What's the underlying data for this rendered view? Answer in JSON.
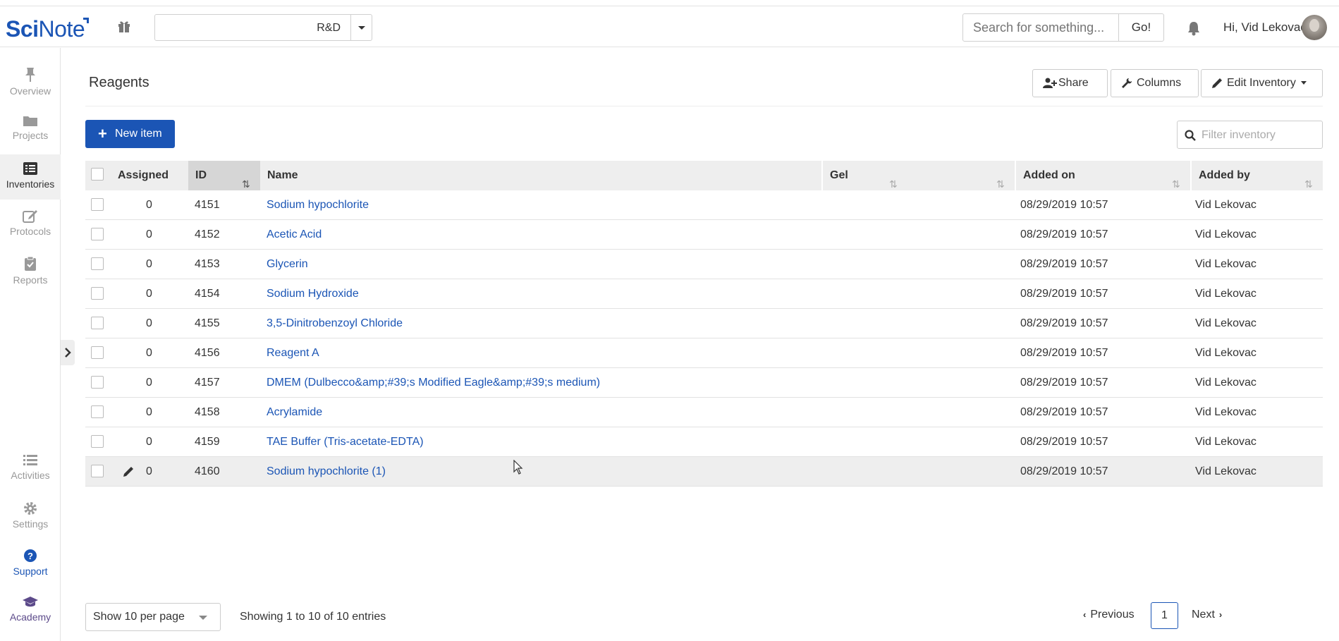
{
  "brand": {
    "logo_sci": "Sci",
    "logo_note": "Note"
  },
  "header": {
    "team": "R&D",
    "search_placeholder": "Search for something...",
    "go_label": "Go!",
    "greeting": "Hi, Vid Lekovac"
  },
  "sidebar": {
    "items": [
      {
        "label": "Overview"
      },
      {
        "label": "Projects"
      },
      {
        "label": "Inventories"
      },
      {
        "label": "Protocols"
      },
      {
        "label": "Reports"
      }
    ],
    "bottom": [
      {
        "label": "Activities"
      },
      {
        "label": "Settings"
      },
      {
        "label": "Support"
      },
      {
        "label": "Academy"
      }
    ]
  },
  "page": {
    "title": "Reagents",
    "share_label": "Share",
    "columns_label": "Columns",
    "edit_label": "Edit Inventory",
    "new_item_label": "New item",
    "filter_placeholder": "Filter inventory"
  },
  "table": {
    "headers": {
      "assigned": "Assigned",
      "id": "ID",
      "name": "Name",
      "gel": "Gel",
      "added_on": "Added on",
      "added_by": "Added by"
    },
    "rows": [
      {
        "assigned": "0",
        "id": "4151",
        "name": "Sodium hypochlorite",
        "gel": "",
        "added_on": "08/29/2019 10:57",
        "added_by": "Vid Lekovac"
      },
      {
        "assigned": "0",
        "id": "4152",
        "name": "Acetic Acid",
        "gel": "",
        "added_on": "08/29/2019 10:57",
        "added_by": "Vid Lekovac"
      },
      {
        "assigned": "0",
        "id": "4153",
        "name": "Glycerin",
        "gel": "",
        "added_on": "08/29/2019 10:57",
        "added_by": "Vid Lekovac"
      },
      {
        "assigned": "0",
        "id": "4154",
        "name": "Sodium Hydroxide",
        "gel": "",
        "added_on": "08/29/2019 10:57",
        "added_by": "Vid Lekovac"
      },
      {
        "assigned": "0",
        "id": "4155",
        "name": "3,5-Dinitrobenzoyl Chloride",
        "gel": "",
        "added_on": "08/29/2019 10:57",
        "added_by": "Vid Lekovac"
      },
      {
        "assigned": "0",
        "id": "4156",
        "name": "Reagent A",
        "gel": "",
        "added_on": "08/29/2019 10:57",
        "added_by": "Vid Lekovac"
      },
      {
        "assigned": "0",
        "id": "4157",
        "name": "DMEM (Dulbecco&amp;#39;s Modified Eagle&amp;#39;s medium)",
        "gel": "",
        "added_on": "08/29/2019 10:57",
        "added_by": "Vid Lekovac"
      },
      {
        "assigned": "0",
        "id": "4158",
        "name": "Acrylamide",
        "gel": "",
        "added_on": "08/29/2019 10:57",
        "added_by": "Vid Lekovac"
      },
      {
        "assigned": "0",
        "id": "4159",
        "name": "TAE Buffer (Tris-acetate-EDTA)",
        "gel": "",
        "added_on": "08/29/2019 10:57",
        "added_by": "Vid Lekovac"
      },
      {
        "assigned": "0",
        "id": "4160",
        "name": "Sodium hypochlorite (1)",
        "gel": "",
        "added_on": "08/29/2019 10:57",
        "added_by": "Vid Lekovac"
      }
    ]
  },
  "footer": {
    "per_page": "Show 10 per page",
    "showing": "Showing 1 to 10 of 10 entries",
    "previous": "Previous",
    "current_page": "1",
    "next": "Next"
  },
  "colors": {
    "accent": "#1b55b5",
    "header_bg": "#eeeeee",
    "sorted_header_bg": "#d6d6d6"
  }
}
